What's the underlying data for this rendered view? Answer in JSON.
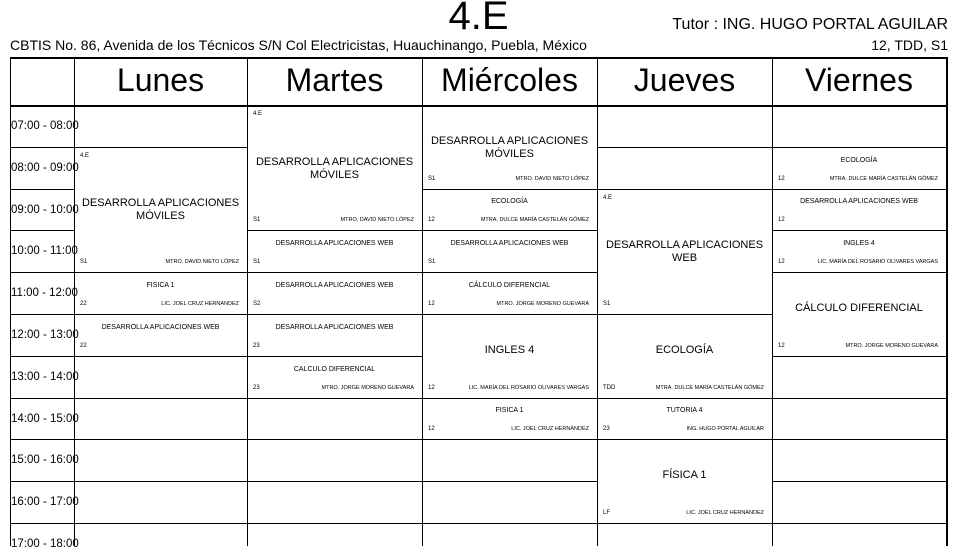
{
  "header": {
    "title": "4.E",
    "tutor": "Tutor : ING. HUGO PORTAL AGUILAR",
    "school": "CBTIS No. 86, Avenida de los Técnicos S/N Col Electricistas, Huauchinango, Puebla, México",
    "group_info": "12, TDD, S1"
  },
  "days": [
    "Lunes",
    "Martes",
    "Miércoles",
    "Jueves",
    "Viernes"
  ],
  "times": [
    "07:00 - 08:00",
    "08:00 - 09:00",
    "09:00 - 10:00",
    "10:00 - 11:00",
    "11:00 - 12:00",
    "12:00 - 13:00",
    "13:00 - 14:00",
    "14:00 - 15:00",
    "15:00 - 16:00",
    "16:00 - 17:00",
    "17:00 - 18:00"
  ],
  "classes": [
    {
      "day": 0,
      "start": 1,
      "span": 3,
      "group": "4.E",
      "subject": "DESARROLLA APLICACIONES MÓVILES",
      "room": "S1",
      "teacher": "MTRO. DAVID NIETO LÓPEZ",
      "big": true
    },
    {
      "day": 0,
      "start": 4,
      "span": 1,
      "group": "",
      "subject": "FISICA 1",
      "room": "22",
      "teacher": "LIC. JOEL CRUZ HERNANDEZ",
      "big": false
    },
    {
      "day": 0,
      "start": 5,
      "span": 1,
      "group": "",
      "subject": "DESARROLLA APLICACIONES WEB",
      "room": "22",
      "teacher": "",
      "big": false
    },
    {
      "day": 1,
      "start": 0,
      "span": 3,
      "group": "4.E",
      "subject": "DESARROLLA APLICACIONES MÓVILES",
      "room": "S1",
      "teacher": "MTRO. DAVID NIETO LÓPEZ",
      "big": true
    },
    {
      "day": 1,
      "start": 3,
      "span": 1,
      "group": "",
      "subject": "DESARROLLA APLICACIONES WEB",
      "room": "S1",
      "teacher": "",
      "big": false
    },
    {
      "day": 1,
      "start": 4,
      "span": 1,
      "group": "",
      "subject": "DESARROLLA APLICACIONES WEB",
      "room": "S2",
      "teacher": "",
      "big": false
    },
    {
      "day": 1,
      "start": 5,
      "span": 1,
      "group": "",
      "subject": "DESARROLLA APLICACIONES WEB",
      "room": "23",
      "teacher": "",
      "big": false
    },
    {
      "day": 1,
      "start": 6,
      "span": 1,
      "group": "",
      "subject": "CALCULO DIFERENCIAL",
      "room": "23",
      "teacher": "MTRO. JORGE MORENO GUEVARA",
      "big": false
    },
    {
      "day": 2,
      "start": 0,
      "span": 2,
      "group": "",
      "subject": "DESARROLLA APLICACIONES MÓVILES",
      "room": "S1",
      "teacher": "MTRO. DAVID NIETO LÓPEZ",
      "big": true
    },
    {
      "day": 2,
      "start": 2,
      "span": 1,
      "group": "",
      "subject": "ECOLOGÍA",
      "room": "12",
      "teacher": "MTRA. DULCE MARÍA CASTELÁN GÓMEZ",
      "big": false
    },
    {
      "day": 2,
      "start": 3,
      "span": 1,
      "group": "",
      "subject": "DESARROLLA APLICACIONES WEB",
      "room": "S1",
      "teacher": "",
      "big": false
    },
    {
      "day": 2,
      "start": 4,
      "span": 1,
      "group": "",
      "subject": "CÁLCULO DIFERENCIAL",
      "room": "12",
      "teacher": "MTRO. JORGE MORENO GUEVARA",
      "big": false
    },
    {
      "day": 2,
      "start": 5,
      "span": 2,
      "group": "",
      "subject": "INGLES 4",
      "room": "12",
      "teacher": "LIC. MARÍA DEL ROSARIO OLIVARES VARGAS",
      "big": true
    },
    {
      "day": 2,
      "start": 7,
      "span": 1,
      "group": "",
      "subject": "FISICA 1",
      "room": "12",
      "teacher": "LIC. JOEL CRUZ HERNANDEZ",
      "big": false
    },
    {
      "day": 3,
      "start": 2,
      "span": 3,
      "group": "4.E",
      "subject": "DESARROLLA APLICACIONES WEB",
      "room": "S1",
      "teacher": "",
      "big": true
    },
    {
      "day": 3,
      "start": 5,
      "span": 2,
      "group": "",
      "subject": "ECOLOGÍA",
      "room": "TDD",
      "teacher": "MTRA. DULCE MARÍA CASTELÁN GÓMEZ",
      "big": true
    },
    {
      "day": 3,
      "start": 7,
      "span": 1,
      "group": "",
      "subject": "TUTORIA 4",
      "room": "23",
      "teacher": "ING. HUGO PORTAL AGUILAR",
      "big": false
    },
    {
      "day": 3,
      "start": 8,
      "span": 2,
      "group": "",
      "subject": "FÍSICA 1",
      "room": "LF",
      "teacher": "LIC. JOEL CRUZ HERNANDEZ",
      "big": true
    },
    {
      "day": 4,
      "start": 1,
      "span": 1,
      "group": "",
      "subject": "ECOLOGÍA",
      "room": "12",
      "teacher": "MTRA. DULCE MARÍA CASTELÁN GÓMEZ",
      "big": false
    },
    {
      "day": 4,
      "start": 2,
      "span": 1,
      "group": "",
      "subject": "DESARROLLA APLICACIONES WEB",
      "room": "12",
      "teacher": "",
      "big": false
    },
    {
      "day": 4,
      "start": 3,
      "span": 1,
      "group": "",
      "subject": "INGLES 4",
      "room": "12",
      "teacher": "LIC. MARÍA DEL ROSARIO OLIVARES VARGAS",
      "big": false
    },
    {
      "day": 4,
      "start": 4,
      "span": 2,
      "group": "",
      "subject": "CÁLCULO DIFERENCIAL",
      "room": "12",
      "teacher": "MTRO. JORGE MORENO GUEVARA",
      "big": true
    }
  ]
}
